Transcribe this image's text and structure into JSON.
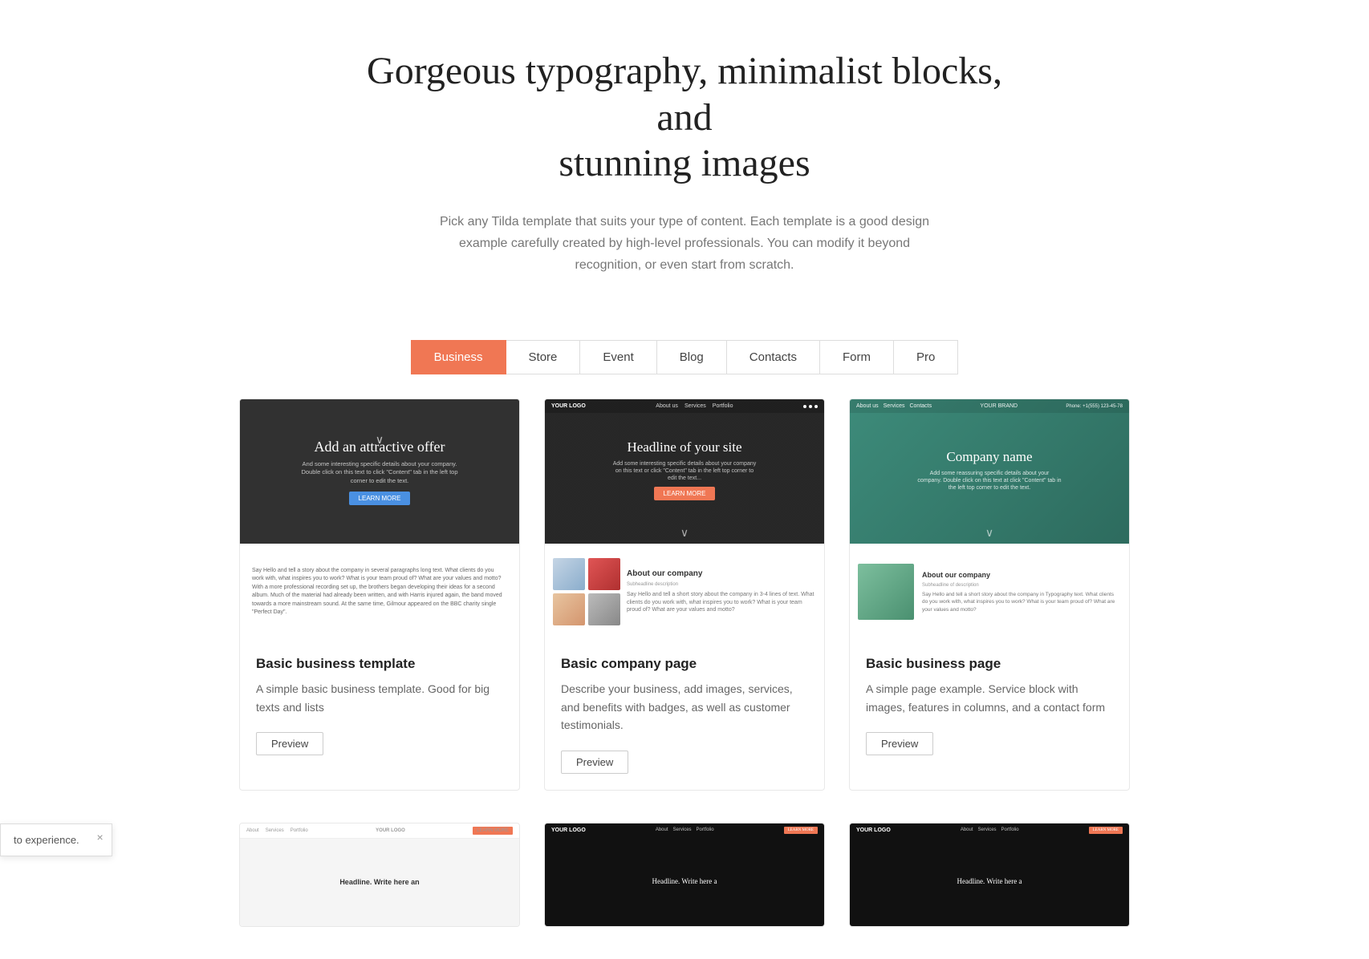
{
  "hero": {
    "title_line1": "Gorgeous typography, minimalist blocks, and",
    "title_line2": "stunning images",
    "description": "Pick any Tilda template that suits your type of content. Each template is a good design example carefully created by high-level professionals. You can modify it beyond recognition, or even start from scratch."
  },
  "tabs": [
    {
      "id": "business",
      "label": "Business",
      "active": true
    },
    {
      "id": "store",
      "label": "Store",
      "active": false
    },
    {
      "id": "event",
      "label": "Event",
      "active": false
    },
    {
      "id": "blog",
      "label": "Blog",
      "active": false
    },
    {
      "id": "contacts",
      "label": "Contacts",
      "active": false
    },
    {
      "id": "form",
      "label": "Form",
      "active": false
    },
    {
      "id": "pro",
      "label": "Pro",
      "active": false
    }
  ],
  "cards": [
    {
      "id": "card-1",
      "preview": {
        "type": "dark-split",
        "hero_text": "Add an attractive offer",
        "hero_sub": "And some interesting specific details about your company. Double click on this text to click \"Content\" tab in the left top corner to edit the text.",
        "btn_label": "LEARN MORE",
        "about_text": "Say Hello and tell a story about the company in several paragraphs long text. What clients do you work with, what inspires you to work? What is your team proud of? What are your values and motto? With a more professional recording set up, the brothers began developing their ideas for a second album. Much of the material had already been written, and with Harris injured again, the band moved towards a more mainstream sound. At the same time, Gilmour appeared on the BBC charity single \"Perfect Day\"."
      },
      "title": "Basic business template",
      "description": "A simple basic business template. Good for big texts and lists",
      "preview_btn": "Preview"
    },
    {
      "id": "card-2",
      "preview": {
        "type": "dark-headline",
        "nav_logo": "YOUR LOGO",
        "nav_links": [
          "About us",
          "Services",
          "Portfolio"
        ],
        "nav_dots": true,
        "hero_text": "Headline of your site",
        "hero_sub": "Add some interesting specific details about your company on this text or click \"Content\" tab in the left top corner to edit the text...",
        "btn_label": "LEARN MORE",
        "about_title": "About our company",
        "about_sub": "Subheadline description",
        "about_body": "Say Hello and tell a short story about the company in 3-4 lines of text. What clients do you work with, what inspires you to work? What is your team proud of? What are your values and motto?"
      },
      "title": "Basic company page",
      "description": "Describe your business, add images, services, and benefits with badges, as well as customer testimonials.",
      "preview_btn": "Preview"
    },
    {
      "id": "card-3",
      "preview": {
        "type": "teal-split",
        "nav_logo": "YOUR BRAND",
        "nav_phone": "Phone: +1(555) 123-45-78",
        "nav_links": [
          "About us",
          "Services",
          "Contacts"
        ],
        "hero_text": "Company name",
        "hero_sub": "Add some reassuring specific details about your company. Double click on this text at click \"Content\" tab in the left top corner to edit the text.",
        "about_title": "About our company",
        "about_sub": "Subheadline of description",
        "about_body": "Say Hello and tell a short story about the company in Typography text. What clients do you work with, what inspires you to work? What is your team proud of? What are your values and motto?"
      },
      "title": "Basic business page",
      "description": "A simple page example. Service block with images, features in columns, and a contact form",
      "preview_btn": "Preview"
    }
  ],
  "bottom_cards": [
    {
      "id": "bottom-1",
      "logo": "YOUR LOGO",
      "cta": "LEARN MORE",
      "headline": "Headline. Write here an",
      "bg": "light"
    },
    {
      "id": "bottom-2",
      "logo": "YOUR LOGO",
      "nav": [
        "About",
        "Services",
        "Portfolio"
      ],
      "cta": "LEARN MORE",
      "headline": "Headline. Write here a",
      "bg": "dark"
    },
    {
      "id": "bottom-3",
      "logo": "YOUR LOGO",
      "nav": [
        "About",
        "Services",
        "Portfolio"
      ],
      "cta": "LEARN MORE",
      "headline": "Headline. Write here a",
      "bg": "dark"
    }
  ],
  "toast": {
    "text": "to experience.",
    "close": "×"
  },
  "colors": {
    "accent": "#f07754",
    "dark": "#1a1a1a",
    "teal": "#2d7d6e"
  }
}
